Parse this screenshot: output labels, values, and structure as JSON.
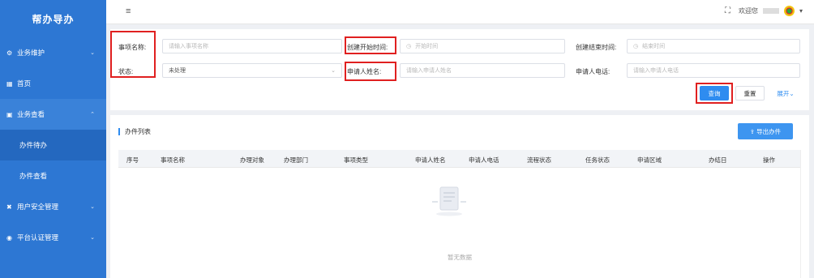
{
  "sidebar": {
    "title": "帮办导办",
    "items": [
      {
        "label": "业务维护",
        "icon": "gear-icon",
        "chevron": "⌄"
      },
      {
        "label": "首页",
        "icon": "grid-icon"
      },
      {
        "label": "业务查看",
        "icon": "document-icon",
        "chevron": "⌃"
      },
      {
        "label": "办件待办"
      },
      {
        "label": "办件查看"
      },
      {
        "label": "用户安全管理",
        "icon": "tools-icon",
        "chevron": "⌄"
      },
      {
        "label": "平台认证管理",
        "icon": "shield-icon",
        "chevron": "⌄"
      }
    ]
  },
  "header": {
    "menu_icon": "≡",
    "fullscreen_icon": "⛶",
    "welcome": "欢迎您",
    "dropdown": "▾"
  },
  "filter": {
    "item_name_label": "事项名称:",
    "item_name_placeholder": "请输入事项名称",
    "start_time_label": "创建开始时间:",
    "start_time_placeholder": "开始时间",
    "end_time_label": "创建结束时间:",
    "end_time_placeholder": "结束时间",
    "status_label": "状态:",
    "status_value": "未处理",
    "applicant_label": "申请人姓名:",
    "applicant_placeholder": "请输入申请人姓名",
    "phone_label": "申请人电话:",
    "phone_placeholder": "请输入申请人电话",
    "query_button": "查询",
    "reset_button": "重置",
    "expand_link": "展开⌄"
  },
  "list": {
    "title": "办件列表",
    "export_button": "⇪ 导出办件",
    "columns": [
      "序号",
      "事项名称",
      "办理对象",
      "办理部门",
      "事项类型",
      "申请人姓名",
      "申请人电话",
      "流程状态",
      "任务状态",
      "申请区域",
      "办结日",
      "操作"
    ],
    "empty_text": "暂无数据"
  },
  "colors": {
    "sidebar": "#2d77d3",
    "primary": "#2e8cf0",
    "highlight": "#e02020"
  }
}
